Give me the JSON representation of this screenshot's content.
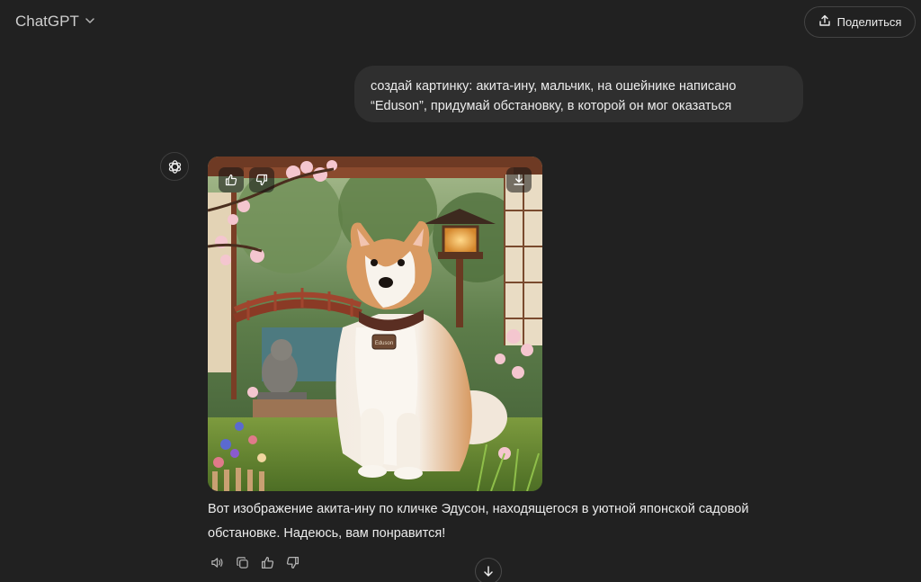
{
  "header": {
    "model_name": "ChatGPT",
    "share_label": "Поделиться"
  },
  "conversation": {
    "user_message": {
      "line1": "создай картинку: акита-ину, мальчик, на ошейнике написано",
      "line2": "“Eduson”, придумай обстановку, в которой он мог оказаться"
    },
    "assistant_message": {
      "line1": "Вот изображение акита-ину по кличке Эдусон, находящегося в уютной японской садовой",
      "line2": "обстановке. Надеюсь, вам понравится!"
    }
  },
  "image": {
    "tag_text": "Eduson",
    "icons": [
      "thumbs-up-icon",
      "thumbs-down-icon",
      "download-icon"
    ]
  },
  "actions": [
    "read-aloud-icon",
    "copy-icon",
    "thumbs-up-icon",
    "thumbs-down-icon"
  ],
  "colors": {
    "background": "#212121",
    "bubble": "#2f2f2f",
    "text": "#ececec"
  }
}
